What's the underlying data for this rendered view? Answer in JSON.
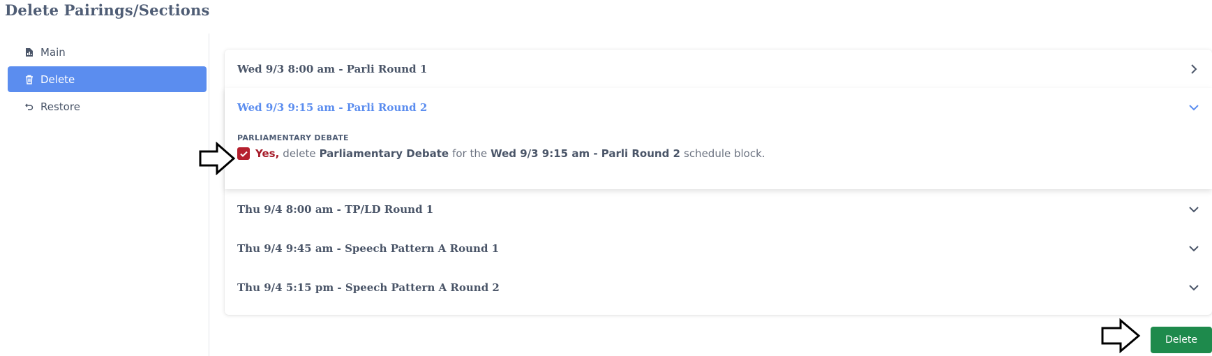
{
  "page": {
    "title": "Delete Pairings/Sections"
  },
  "sidebar": {
    "items": [
      {
        "label": "Main",
        "icon": "file-chart-icon",
        "active": false
      },
      {
        "label": "Delete",
        "icon": "trash-icon",
        "active": true
      },
      {
        "label": "Restore",
        "icon": "undo-icon",
        "active": false
      }
    ]
  },
  "rounds": [
    {
      "title": "Wed 9/3 8:00 am - Parli Round 1",
      "state": "collapsed-right"
    },
    {
      "title": "Wed 9/3 9:15 am - Parli Round 2",
      "state": "expanded"
    },
    {
      "title": "Thu 9/4 8:00 am - TP/LD Round 1",
      "state": "collapsed"
    },
    {
      "title": "Thu 9/4 9:45 am - Speech Pattern A Round 1",
      "state": "collapsed"
    },
    {
      "title": "Thu 9/4 5:15 pm - Speech Pattern A Round 2",
      "state": "collapsed"
    }
  ],
  "expanded": {
    "section_label": "PARLIAMENTARY DEBATE",
    "checked": true,
    "yes": "Yes,",
    "text1": "delete",
    "event": "Parliamentary Debate",
    "text2": "for the",
    "block": "Wed 9/3 9:15 am - Parli Round 2",
    "text3": "schedule block."
  },
  "actions": {
    "delete_label": "Delete"
  },
  "colors": {
    "accent": "#5b8def",
    "danger": "#b5202e",
    "success": "#1e8a4c",
    "text": "#4a5568"
  }
}
